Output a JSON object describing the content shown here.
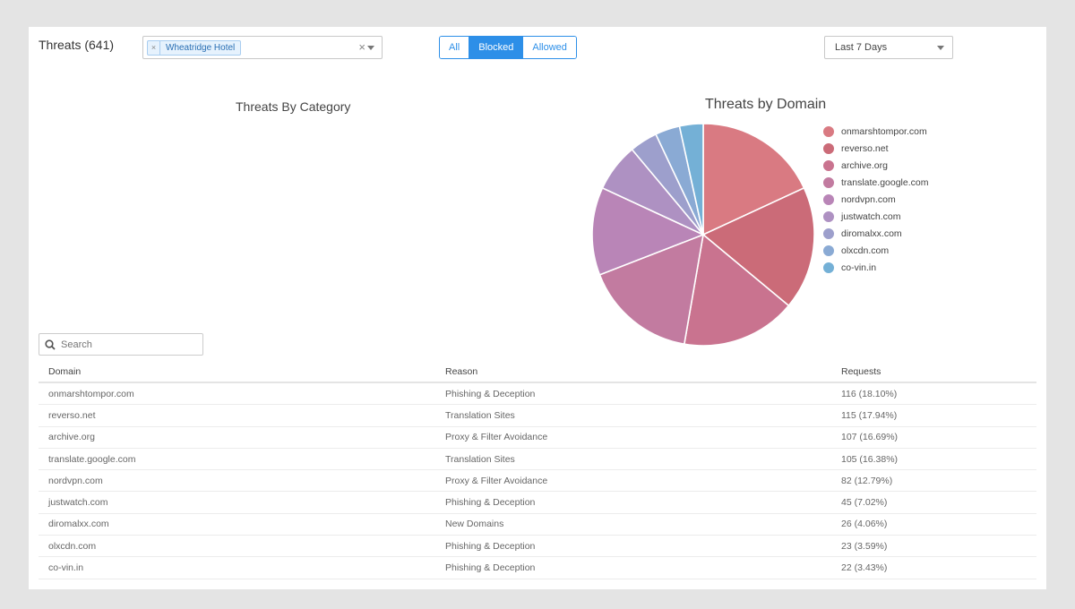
{
  "header": {
    "title": "Threats (641)",
    "selected_tag": "Wheatridge Hotel",
    "tag_remove": "×",
    "clear": "×"
  },
  "filter_tabs": [
    "All",
    "Blocked",
    "Allowed"
  ],
  "active_tab": "Blocked",
  "date_range": "Last 7 Days",
  "charts": {
    "category_title": "Threats By Category",
    "domain_title": "Threats by Domain"
  },
  "chart_data": {
    "type": "pie",
    "title": "Threats by Domain",
    "labels": [
      "onmarshtompor.com",
      "reverso.net",
      "archive.org",
      "translate.google.com",
      "nordvpn.com",
      "justwatch.com",
      "diromalxx.com",
      "olxcdn.com",
      "co-vin.in"
    ],
    "values": [
      116,
      115,
      107,
      105,
      82,
      45,
      26,
      23,
      22
    ],
    "colors": [
      "#d97a82",
      "#cb6b78",
      "#c9738f",
      "#c27ba0",
      "#b985b7",
      "#ae91c2",
      "#9d9fcc",
      "#8aaad4",
      "#74b0d6"
    ],
    "legend_position": "right"
  },
  "search": {
    "placeholder": "Search"
  },
  "table": {
    "columns": [
      "Domain",
      "Reason",
      "Requests"
    ],
    "rows": [
      [
        "onmarshtompor.com",
        "Phishing & Deception",
        "116 (18.10%)"
      ],
      [
        "reverso.net",
        "Translation Sites",
        "115 (17.94%)"
      ],
      [
        "archive.org",
        "Proxy & Filter Avoidance",
        "107 (16.69%)"
      ],
      [
        "translate.google.com",
        "Translation Sites",
        "105 (16.38%)"
      ],
      [
        "nordvpn.com",
        "Proxy & Filter Avoidance",
        "82 (12.79%)"
      ],
      [
        "justwatch.com",
        "Phishing & Deception",
        "45 (7.02%)"
      ],
      [
        "diromalxx.com",
        "New Domains",
        "26 (4.06%)"
      ],
      [
        "olxcdn.com",
        "Phishing & Deception",
        "23 (3.59%)"
      ],
      [
        "co-vin.in",
        "Phishing & Deception",
        "22 (3.43%)"
      ]
    ]
  }
}
